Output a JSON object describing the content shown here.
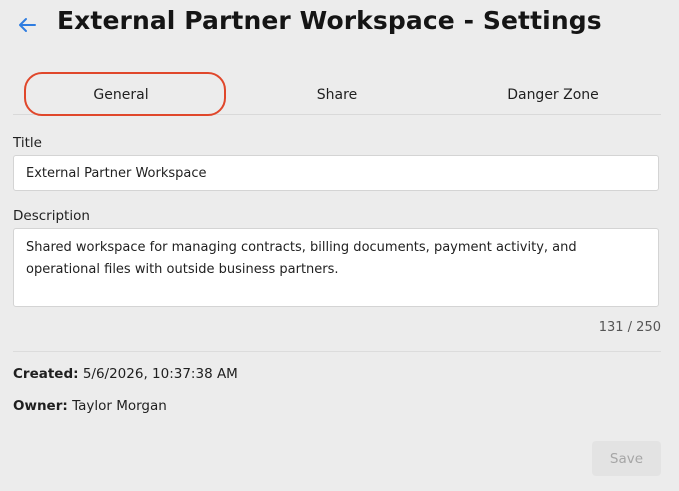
{
  "header": {
    "title": "External Partner Workspace - Settings",
    "back_icon": "arrow-left-icon"
  },
  "tabs": [
    {
      "label": "General",
      "active": true
    },
    {
      "label": "Share",
      "active": false
    },
    {
      "label": "Danger Zone",
      "active": false
    }
  ],
  "form": {
    "title_label": "Title",
    "title_value": "External Partner Workspace",
    "description_label": "Description",
    "description_value": "Shared workspace for managing contracts, billing documents, payment activity, and operational files with outside business partners.",
    "char_count": "131 / 250"
  },
  "meta": {
    "created_label": "Created:",
    "created_value": "5/6/2026, 10:37:38 AM",
    "owner_label": "Owner:",
    "owner_value": "Taylor Morgan"
  },
  "actions": {
    "save_label": "Save",
    "save_disabled": true
  },
  "colors": {
    "accent": "#2f7de1",
    "highlight": "#e0472b",
    "background": "#ececec"
  }
}
